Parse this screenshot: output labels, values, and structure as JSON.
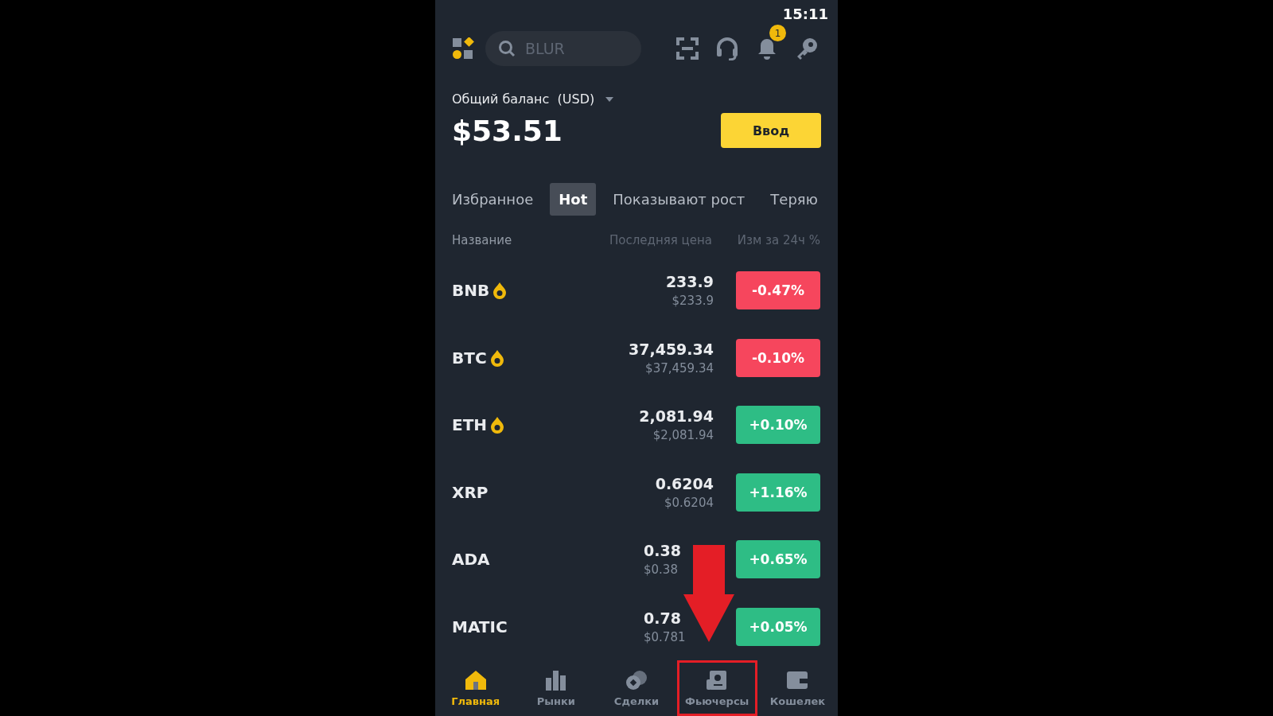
{
  "status_bar": {
    "time": "15:11"
  },
  "header": {
    "search": {
      "placeholder": "BLUR"
    },
    "notifications": {
      "badge": "1"
    }
  },
  "balance": {
    "label": "Общий баланс  (USD)",
    "amount": "$53.51",
    "deposit_button": "Ввод"
  },
  "tabs": [
    {
      "label": "Избранное",
      "selected": false
    },
    {
      "label": "Hot",
      "selected": true
    },
    {
      "label": "Показывают рост",
      "selected": false
    },
    {
      "label": "Теряю",
      "selected": false
    }
  ],
  "table": {
    "columns": [
      "Название",
      "Последняя цена",
      "Изм за 24ч %"
    ],
    "rows": [
      {
        "symbol": "BNB",
        "hot": true,
        "price": "233.9",
        "usd": "$233.9",
        "change": "-0.47%",
        "color": "#f6465d",
        "obscured": false
      },
      {
        "symbol": "BTC",
        "hot": true,
        "price": "37,459.34",
        "usd": "$37,459.34",
        "change": "-0.10%",
        "color": "#f6465d",
        "obscured": false
      },
      {
        "symbol": "ETH",
        "hot": true,
        "price": "2,081.94",
        "usd": "$2,081.94",
        "change": "+0.10%",
        "color": "#2ebd85",
        "obscured": false
      },
      {
        "symbol": "XRP",
        "hot": false,
        "price": "0.6204",
        "usd": "$0.6204",
        "change": "+1.16%",
        "color": "#2ebd85",
        "obscured": false
      },
      {
        "symbol": "ADA",
        "hot": false,
        "price": "0.38",
        "usd": "$0.38",
        "change": "+0.65%",
        "color": "#2ebd85",
        "obscured": true
      },
      {
        "symbol": "MATIC",
        "hot": false,
        "price": "0.78",
        "usd": "$0.781",
        "change": "+0.05%",
        "color": "#2ebd85",
        "obscured": true
      }
    ]
  },
  "nav": [
    {
      "kind": "home",
      "label": "Главная",
      "selected": true,
      "highlighted": false
    },
    {
      "kind": "markets",
      "label": "Рынки",
      "selected": false,
      "highlighted": false
    },
    {
      "kind": "trades",
      "label": "Сделки",
      "selected": false,
      "highlighted": false
    },
    {
      "kind": "futures",
      "label": "Фьючерсы",
      "selected": false,
      "highlighted": true
    },
    {
      "kind": "wallet",
      "label": "Кошелек",
      "selected": false,
      "highlighted": false
    }
  ]
}
